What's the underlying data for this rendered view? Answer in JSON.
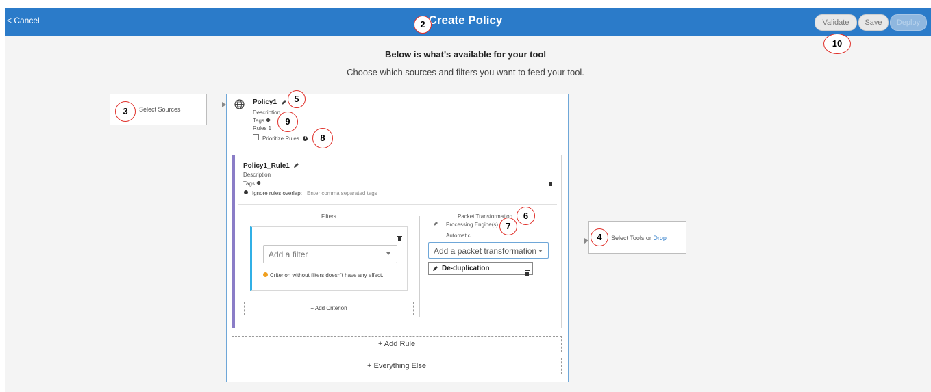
{
  "header": {
    "cancel": "< Cancel",
    "title": "Create Policy",
    "validate": "Validate",
    "save": "Save",
    "deploy": "Deploy"
  },
  "intro": {
    "heading": "Below is what's available for your tool",
    "subheading": "Choose which sources and filters you want to feed your tool."
  },
  "sources_box": {
    "label": "Select Sources"
  },
  "tools_box": {
    "label_a": "Select Tools or ",
    "label_b": "Drop"
  },
  "policy": {
    "name": "Policy1",
    "description": "Description",
    "tags": "Tags",
    "rules": "Rules 1",
    "prioritize": "Prioritize Rules"
  },
  "rule": {
    "name": "Policy1_Rule1",
    "description": "Description",
    "tags": "Tags",
    "ignore_label": "Ignore rules overlap:",
    "ignore_placeholder": "Enter comma separated tags"
  },
  "filters": {
    "title": "Filters",
    "placeholder": "Add a filter",
    "warning": "Criterion without filters doesn't have any effect.",
    "add_criterion": "+ Add Criterion"
  },
  "transformation": {
    "title": "Packet Transformation",
    "engines": "Processing Engine(s)",
    "mode": "Automatic",
    "placeholder": "Add a packet transformation",
    "item": "De-duplication"
  },
  "add_rule": "+ Add Rule",
  "everything_else": "+ Everything Else",
  "markers": [
    "2",
    "3",
    "4",
    "5",
    "6",
    "7",
    "8",
    "9",
    "10"
  ],
  "colors": {
    "header": "#2b7bc9",
    "marker": "#e0302a",
    "rule_accent": "#8a7dc7",
    "filter_accent": "#31b0e6"
  }
}
